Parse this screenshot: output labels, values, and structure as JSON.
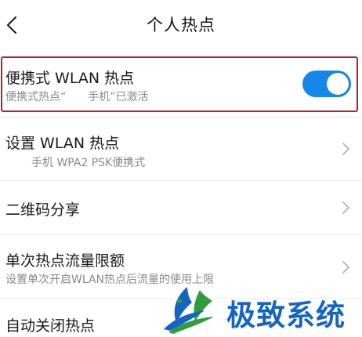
{
  "header": {
    "title": "个人热点"
  },
  "settings": {
    "portable_hotspot": {
      "title": "便携式 WLAN 热点",
      "subtitle": "便携式热点“　　手机”已激活",
      "enabled": true
    },
    "setup_hotspot": {
      "title": "设置 WLAN 热点",
      "subtitle": "手机 WPA2 PSK便携式"
    },
    "qr_share": {
      "title": "二维码分享"
    },
    "data_limit": {
      "title": "单次热点流量限额",
      "subtitle": "设置单次开启WLAN热点后流量的使用上限"
    },
    "auto_close": {
      "title": "自动关闭热点"
    }
  },
  "watermark": {
    "text": "极致系统"
  },
  "colors": {
    "accent": "#1687ea",
    "highlight_border": "#b3202a",
    "watermark_text": "#1565c0",
    "watermark_green": "#2e9d3a"
  }
}
